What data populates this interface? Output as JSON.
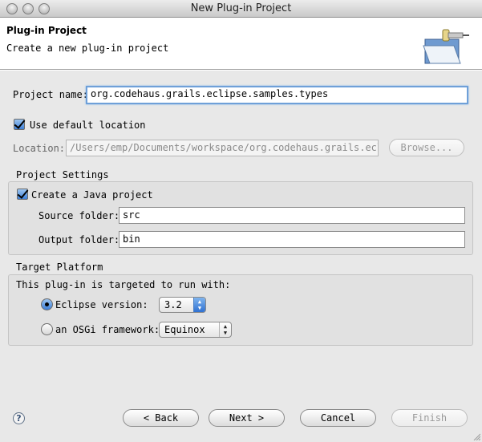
{
  "window": {
    "title": "New Plug-in Project"
  },
  "header": {
    "title": "Plug-in Project",
    "description": "Create a new plug-in project",
    "icon": "wizard-folder-plug-icon"
  },
  "form": {
    "project_name_label": "Project name:",
    "project_name_value": "org.codehaus.grails.eclipse.samples.types",
    "use_default_location_label": "Use default location",
    "use_default_location_checked": true,
    "location_label": "Location:",
    "location_value": "/Users/emp/Documents/workspace/org.codehaus.grails.eclipse",
    "browse_label": "Browse..."
  },
  "project_settings": {
    "title": "Project Settings",
    "create_java_label": "Create a Java project",
    "create_java_checked": true,
    "source_folder_label": "Source folder:",
    "source_folder_value": "src",
    "output_folder_label": "Output folder:",
    "output_folder_value": "bin"
  },
  "target_platform": {
    "title": "Target Platform",
    "intro": "This plug-in is targeted to run with:",
    "eclipse_label": "Eclipse version:",
    "eclipse_selected": true,
    "eclipse_version": "3.2",
    "osgi_label": "an OSGi framework:",
    "osgi_selected": false,
    "osgi_framework": "Equinox"
  },
  "buttons": {
    "help": "?",
    "back": "< Back",
    "next": "Next >",
    "cancel": "Cancel",
    "finish": "Finish",
    "finish_enabled": false
  }
}
